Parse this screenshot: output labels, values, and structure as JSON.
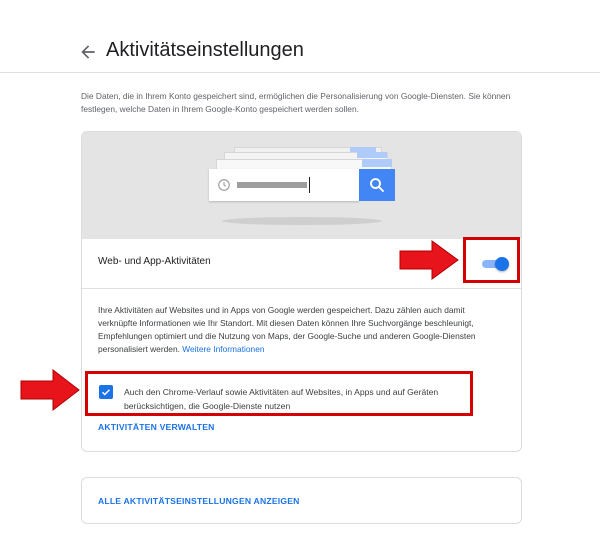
{
  "header": {
    "title": "Aktivitätseinstellungen",
    "back_icon": "arrow-left-icon"
  },
  "intro": {
    "text": "Die Daten, die in Ihrem Konto gespeichert sind, ermöglichen die Personalisierung von Google-Diensten. Sie können festlegen, welche Daten in Ihrem Google-Konto gespeichert werden sollen."
  },
  "activity_card": {
    "illustration": "search-history-illustration",
    "setting_label": "Web- und App-Aktivitäten",
    "toggle_state": "on",
    "description": "Ihre Aktivitäten auf Websites und in Apps von Google werden gespeichert. Dazu zählen auch damit verknüpfte Informationen wie Ihr Standort. Mit diesen Daten können Ihre Suchvorgänge beschleunigt, Empfehlungen optimiert und die Nutzung von Maps, der Google-Suche und anderen Google-Diensten personalisiert werden.",
    "more_info_link": "Weitere Informationen",
    "checkbox_checked": true,
    "checkbox_label": "Auch den Chrome-Verlauf sowie Aktivitäten auf Websites, in Apps und auf Geräten berücksichtigen, die Google-Dienste nutzen",
    "manage_link": "AKTIVITÄTEN VERWALTEN"
  },
  "all_settings_card": {
    "link": "ALLE AKTIVITÄTSEINSTELLUNGEN ANZEIGEN"
  },
  "colors": {
    "accent": "#1a73e8",
    "highlight": "#d50000",
    "arrow": "#e8141b"
  }
}
